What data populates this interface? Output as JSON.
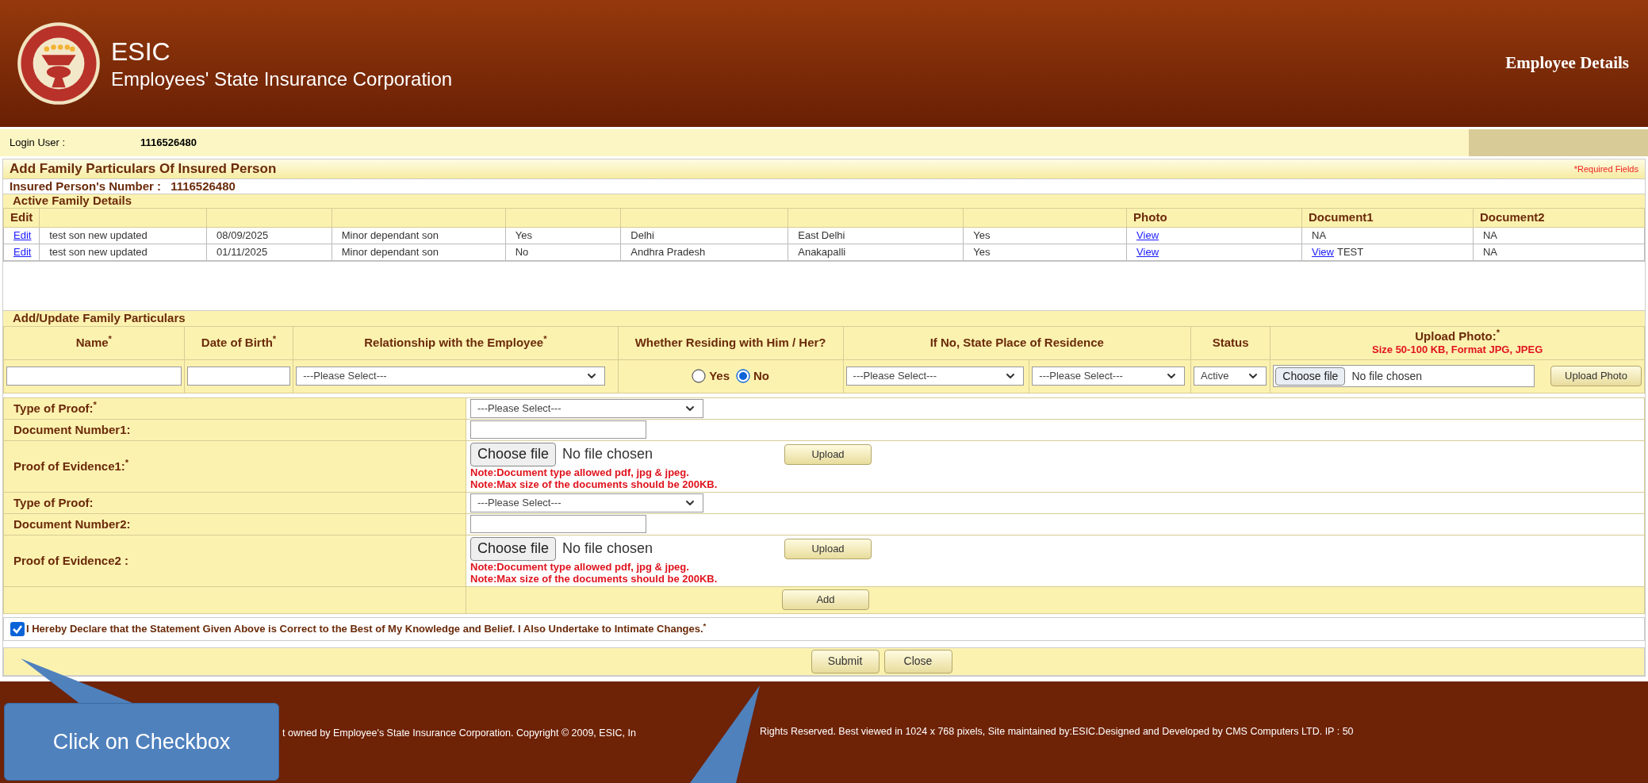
{
  "header": {
    "org_short": "ESIC",
    "org_name": "Employees' State Insurance Corporation",
    "page_title": "Employee Details"
  },
  "login": {
    "label": "Login User :",
    "value": "1116526480"
  },
  "section_title": "Add Family Particulars Of Insured Person",
  "required_note": "*Required Fields",
  "insured_number": {
    "label": "Insured Person's Number :",
    "value": "1116526480"
  },
  "active_family": {
    "title": "Active Family Details",
    "columns": [
      {
        "heading": "Edit"
      },
      {},
      {},
      {},
      {},
      {},
      {},
      {},
      {
        "heading": "Photo"
      },
      {
        "heading": "Document1"
      },
      {
        "heading": "Document2"
      }
    ],
    "rows": [
      {
        "cells": [
          {
            "link": "Edit"
          },
          {
            "text": "test son new updated"
          },
          {
            "text": "08/09/2025"
          },
          {
            "text": "Minor dependant son"
          },
          {
            "text": "Yes"
          },
          {
            "text": "Delhi"
          },
          {
            "text": "East Delhi"
          },
          {
            "text": "Yes"
          },
          {
            "link": "View"
          },
          {
            "text": "NA"
          },
          {
            "text": "NA"
          }
        ]
      },
      {
        "cells": [
          {
            "link": "Edit"
          },
          {
            "text": "test son new updated"
          },
          {
            "text": "01/11/2025"
          },
          {
            "text": "Minor dependant son"
          },
          {
            "text": "No"
          },
          {
            "text": "Andhra Pradesh"
          },
          {
            "text": "Anakapalli"
          },
          {
            "text": "Yes"
          },
          {
            "link": "View"
          },
          {
            "link": "View",
            "text": "TEST"
          },
          {
            "text": "NA"
          }
        ]
      }
    ]
  },
  "add_update": {
    "title": "Add/Update Family Particulars",
    "columns": {
      "name": "Name$^{*}$",
      "dob": "Date of Birth$^{*}$",
      "relationship": "Relationship with the Employee$^{*}$",
      "residing": "Whether Residing with Him / Her?",
      "residence": "If No, State Place of Residence",
      "status": "Status",
      "upload": "Upload Photo:$^{*}$",
      "upload_note": "Size 50-100 KB, Format JPG, JPEG"
    },
    "relationship_select": "---Please Select---",
    "residing_options": [
      {
        "label": "Yes",
        "selected": false
      },
      {
        "label": "No",
        "selected": true
      }
    ],
    "residence_selects": [
      "---Please Select---",
      "---Please Select---"
    ],
    "status_select": "Active",
    "photo_file": {
      "button": "Choose file",
      "value": "No file chosen"
    },
    "upload_photo_button": "Upload Photo"
  },
  "proofs": [
    {
      "kind": "select",
      "label": "Type of Proof:$^{*}$",
      "value": "---Please Select---"
    },
    {
      "kind": "text",
      "label": "Document Number1:"
    },
    {
      "kind": "file",
      "label": "Proof of Evidence1:$^{*}$",
      "button": "Choose file",
      "value": "No file chosen",
      "upload": "Upload",
      "notes": [
        "Note:Document type allowed pdf, jpg & jpeg.",
        "Note:Max size of the documents should be 200KB."
      ]
    },
    {
      "kind": "select",
      "label": "Type of Proof:",
      "value": "---Please Select---"
    },
    {
      "kind": "text",
      "label": "Document Number2:"
    },
    {
      "kind": "file",
      "label": "Proof of Evidence2 :",
      "button": "Choose file",
      "value": "No file chosen",
      "upload": "Upload",
      "notes": [
        "Note:Document type allowed pdf, jpg & jpeg.",
        "Note:Max size of the documents should be 200KB."
      ]
    }
  ],
  "add_button": "Add",
  "declaration": {
    "checked": true,
    "text": "I Hereby Declare that the Statement Given Above is Correct to the Best of My Knowledge and Belief. I Also Undertake to Intimate Changes.$^{*}$"
  },
  "buttons": [
    "Submit",
    "Close"
  ],
  "footer": [
    "t owned by Employee's State Insurance Corporation. Copyright © 2009, ESIC, In",
    "Rights Reserved. Best viewed in 1024 x 768 pixels, Site maintained by:ESIC.Designed and Developed by CMS Computers LTD. IP : 50"
  ],
  "callout": {
    "text": "Click on Checkbox"
  }
}
